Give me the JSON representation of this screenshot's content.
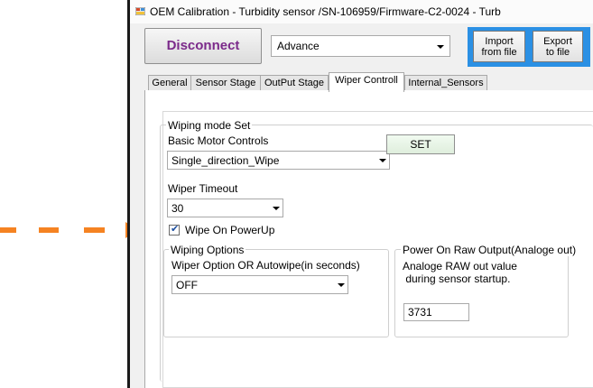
{
  "window": {
    "title": "OEM Calibration - Turbidity sensor /SN-106959/Firmware-C2-0024 - Turb"
  },
  "toolbar": {
    "disconnect_label": "Disconnect",
    "mode_value": "Advance",
    "import_label_1": "Import",
    "import_label_2": "from file",
    "export_label_1": "Export",
    "export_label_2": "to file"
  },
  "tabs": [
    {
      "label": "General"
    },
    {
      "label": "Sensor Stage"
    },
    {
      "label": "OutPut Stage"
    },
    {
      "label": "Wiper Controll"
    },
    {
      "label": "Internal_Sensors"
    }
  ],
  "wiper_tab": {
    "wiping_mode_title": "Wiping mode Set",
    "basic_motor_label": "Basic Motor Controls",
    "basic_motor_value": "Single_direction_Wipe",
    "set_label": "SET",
    "timeout_label": "Wiper Timeout",
    "timeout_value": "30",
    "wipe_on_powerup_label": "Wipe On PowerUp",
    "wipe_on_powerup_checked": true,
    "wiping_options_title": "Wiping Options",
    "wiper_option_label": "Wiper Option OR Autowipe(in seconds)",
    "wiper_option_value": "OFF",
    "power_on_title": "Power On Raw Output(Analoge out)",
    "raw_desc_1": "Analoge RAW out value",
    "raw_desc_2": " during sensor startup.",
    "raw_value": "3731"
  },
  "colors": {
    "accent_blue": "#2b90e4",
    "disconnect_text": "#7b2a8a",
    "annotation_arrow": "#f58322"
  }
}
